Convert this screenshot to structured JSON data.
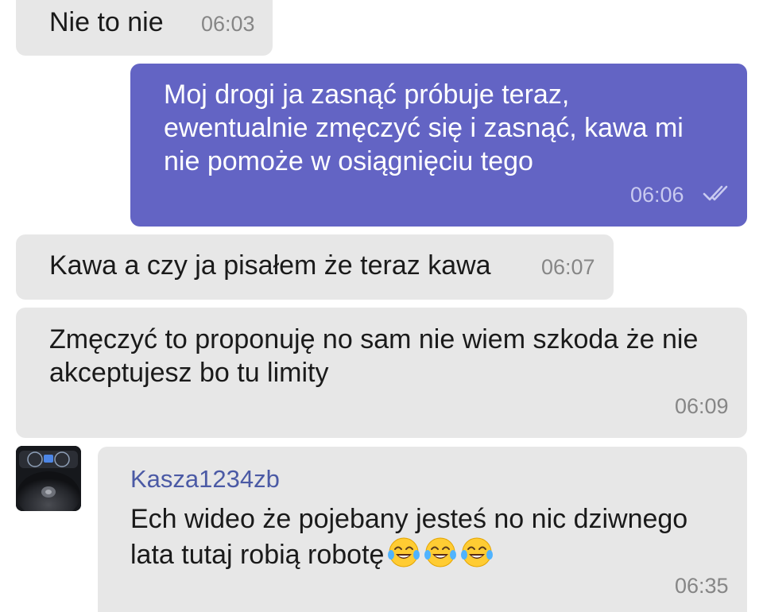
{
  "messages": [
    {
      "text": "Nie to nie",
      "time": "06:03"
    },
    {
      "text": "Moj drogi ja zasnąć próbuje teraz,\newentualnie zmęczyć się i zasnąć, kawa mi\nnie pomoże w osiągnięciu tego",
      "time": "06:06",
      "status_icon": "double-check-icon"
    },
    {
      "text": "Kawa a czy ja pisałem że teraz kawa",
      "time": "06:07"
    },
    {
      "text": "Zmęczyć to proponuję no sam nie wiem szkoda że nie\nakceptujesz bo tu limity",
      "time": "06:09"
    },
    {
      "sender": "Kasza1234zb",
      "text": "Ech wideo że pojebany jesteś no nic dziwnego\nlata tutaj robią robotę",
      "emojis": [
        "😂",
        "😂",
        "😂"
      ],
      "time": "06:35"
    }
  ],
  "colors": {
    "incoming_bubble": "#e7e7e7",
    "outgoing_bubble": "#6364c4",
    "sender_name": "#4b5aa5",
    "timestamp": "#868686"
  }
}
